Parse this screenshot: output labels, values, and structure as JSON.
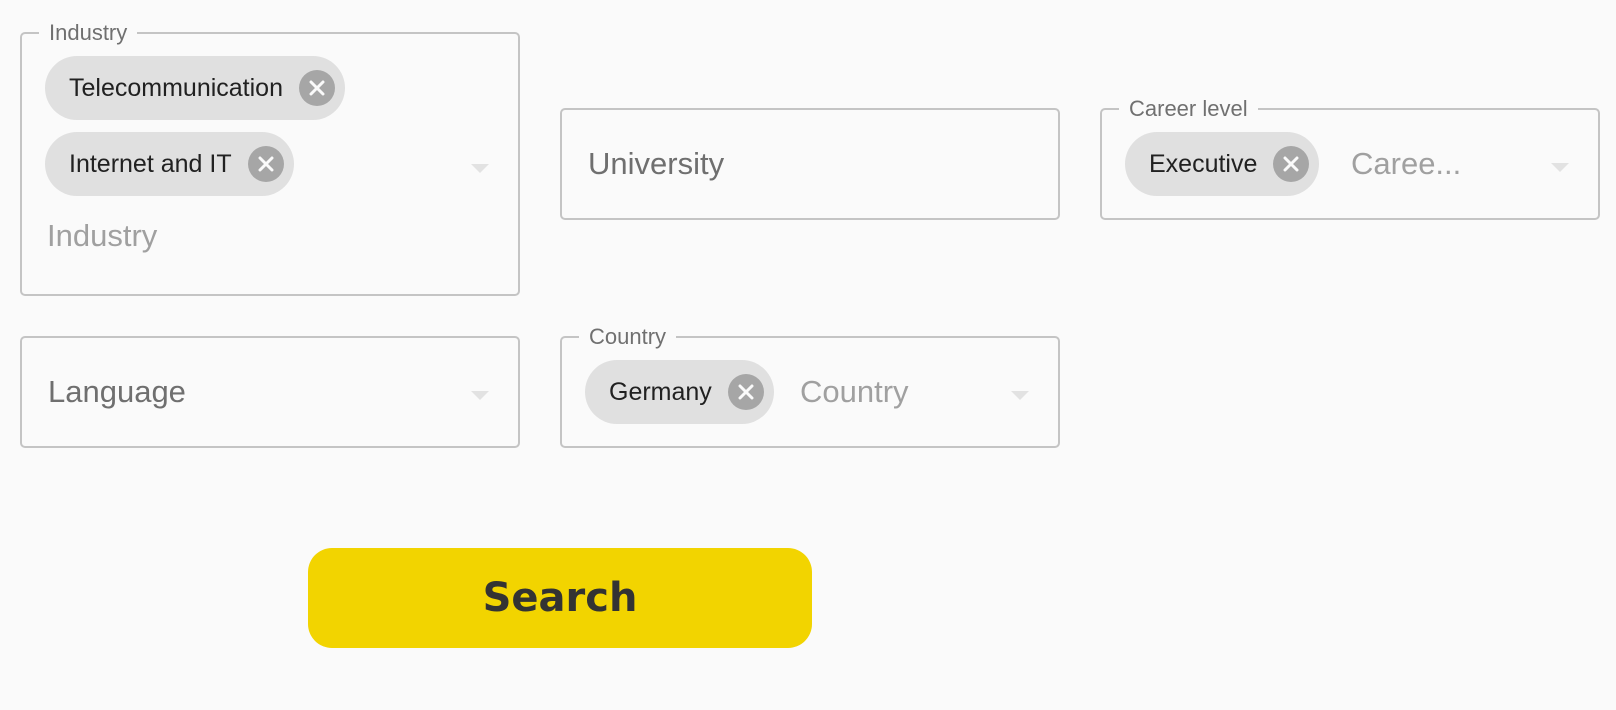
{
  "industry": {
    "legend": "Industry",
    "chips": [
      "Telecommunication",
      "Internet and IT"
    ],
    "placeholder": "Industry"
  },
  "university": {
    "label": "University"
  },
  "career_level": {
    "legend": "Career level",
    "chips": [
      "Executive"
    ],
    "placeholder": "Caree..."
  },
  "language": {
    "label": "Language"
  },
  "country": {
    "legend": "Country",
    "chips": [
      "Germany"
    ],
    "placeholder": "Country"
  },
  "search_button": {
    "label": "Search"
  },
  "colors": {
    "accent": "#f2d400",
    "chip_bg": "#e0e0e0",
    "chip_delete": "#a6a6a6",
    "border": "#c4c4c4"
  },
  "icons": {
    "chip_delete": "close-circle-icon",
    "dropdown": "caret-down-icon"
  }
}
